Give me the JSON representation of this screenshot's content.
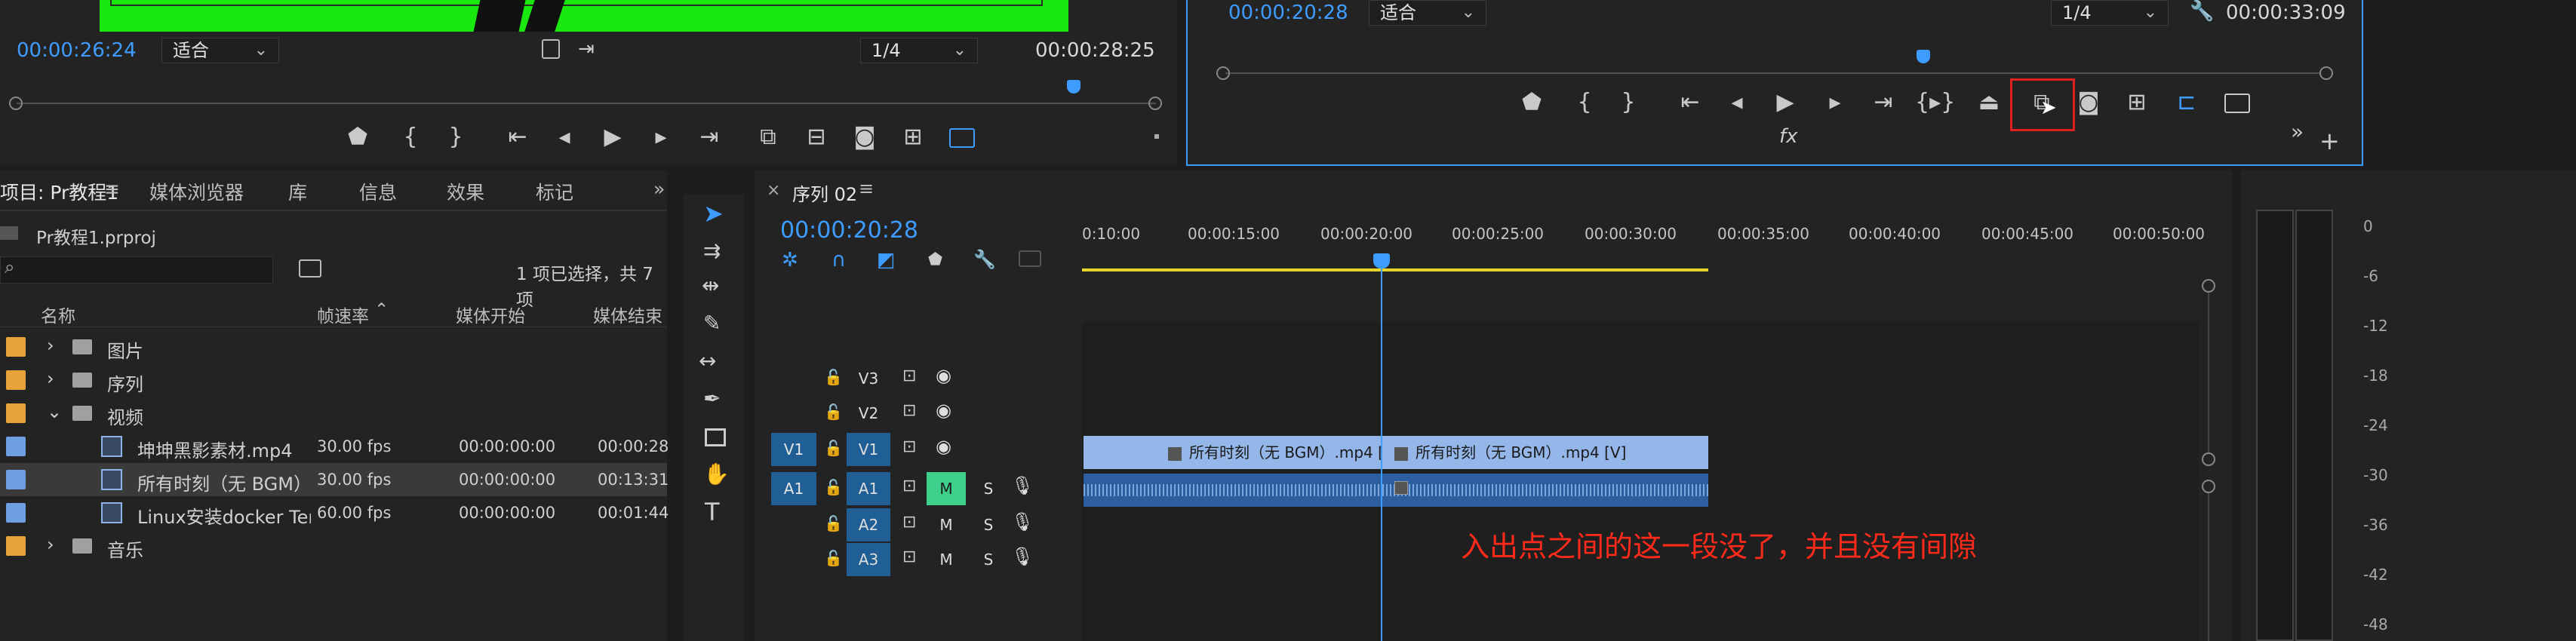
{
  "source_monitor": {
    "timecode_left": "00:00:26:24",
    "fit_label": "适合",
    "resolution": "1/4",
    "timecode_right": "00:00:28:25"
  },
  "program_monitor": {
    "timecode_left": "00:00:20:28",
    "fit_label": "适合",
    "resolution": "1/4",
    "timecode_right": "00:00:33:09",
    "fx_label": "fx"
  },
  "project_panel": {
    "tabs": [
      "项目: Pr教程1",
      "媒体浏览器",
      "库",
      "信息",
      "效果",
      "标记"
    ],
    "project_file": "Pr教程1.prproj",
    "selection_status": "1 项已选择，共 7 项",
    "columns": [
      "名称",
      "帧速率",
      "媒体开始",
      "媒体结束"
    ],
    "rows": [
      {
        "name": "图片",
        "type": "folder",
        "expand": "›",
        "color": "#e8a23a",
        "fps": "",
        "start": "",
        "end": ""
      },
      {
        "name": "序列",
        "type": "folder",
        "expand": "›",
        "color": "#e8a23a",
        "fps": "",
        "start": "",
        "end": ""
      },
      {
        "name": "视频",
        "type": "folder",
        "expand": "⌄",
        "color": "#e8a23a",
        "fps": "",
        "start": "",
        "end": ""
      },
      {
        "name": "坤坤黑影素材.mp4",
        "type": "clip",
        "expand": "",
        "color": "#6e9fe0",
        "fps": "30.00 fps",
        "start": "00:00:00:00",
        "end": "00:00:28"
      },
      {
        "name": "所有时刻（无 BGM）.",
        "type": "clip",
        "expand": "",
        "color": "#6e9fe0",
        "fps": "30.00 fps",
        "start": "00:00:00:00",
        "end": "00:13:31"
      },
      {
        "name": "Linux安装docker Templ",
        "type": "clip",
        "expand": "",
        "color": "#6e9fe0",
        "fps": "60.00 fps",
        "start": "00:00:00:00",
        "end": "00:01:44"
      },
      {
        "name": "音乐",
        "type": "folder",
        "expand": "›",
        "color": "#e8a23a",
        "fps": "",
        "start": "",
        "end": ""
      }
    ]
  },
  "timeline": {
    "tab_label": "序列 02",
    "timecode": "00:00:20:28",
    "ruler_labels": [
      "0:10:00",
      "00:00:15:00",
      "00:00:20:00",
      "00:00:25:00",
      "00:00:30:00",
      "00:00:35:00",
      "00:00:40:00",
      "00:00:45:00",
      "00:00:50:00"
    ],
    "tracks": [
      {
        "id": "V3",
        "source": "",
        "kind": "video"
      },
      {
        "id": "V2",
        "source": "",
        "kind": "video"
      },
      {
        "id": "V1",
        "source": "V1",
        "kind": "video"
      },
      {
        "id": "A1",
        "source": "A1",
        "kind": "audio",
        "m": "M",
        "s": "S"
      },
      {
        "id": "A2",
        "source": "",
        "kind": "audio",
        "m": "M",
        "s": "S"
      },
      {
        "id": "A3",
        "source": "",
        "kind": "audio",
        "m": "M",
        "s": "S"
      }
    ],
    "clips": [
      "所有时刻（无 BGM）.mp4 [V]",
      "所有时刻（无 BGM）.mp4 [V]"
    ],
    "annotation": "入出点之间的这一段没了，并且没有间隙"
  },
  "audio_meter": {
    "labels": [
      "0",
      "-6",
      "-12",
      "-18",
      "-24",
      "-30",
      "-36",
      "-42",
      "-48"
    ]
  },
  "colors": {
    "accent_blue": "#3f9cff",
    "green_screen": "#19e80e",
    "highlight_red": "#e0201e",
    "annotation_red": "#ff2a1a",
    "track_blue": "#1f5f96",
    "mute_green": "#3fd08c",
    "playhead_yellow": "#e7d42a"
  },
  "icons": {
    "toolbar": [
      "selection-tool-icon",
      "track-select-icon",
      "ripple-edit-icon",
      "razor-icon",
      "slip-icon",
      "pen-icon",
      "rectangle-icon",
      "hand-icon",
      "type-icon"
    ]
  }
}
